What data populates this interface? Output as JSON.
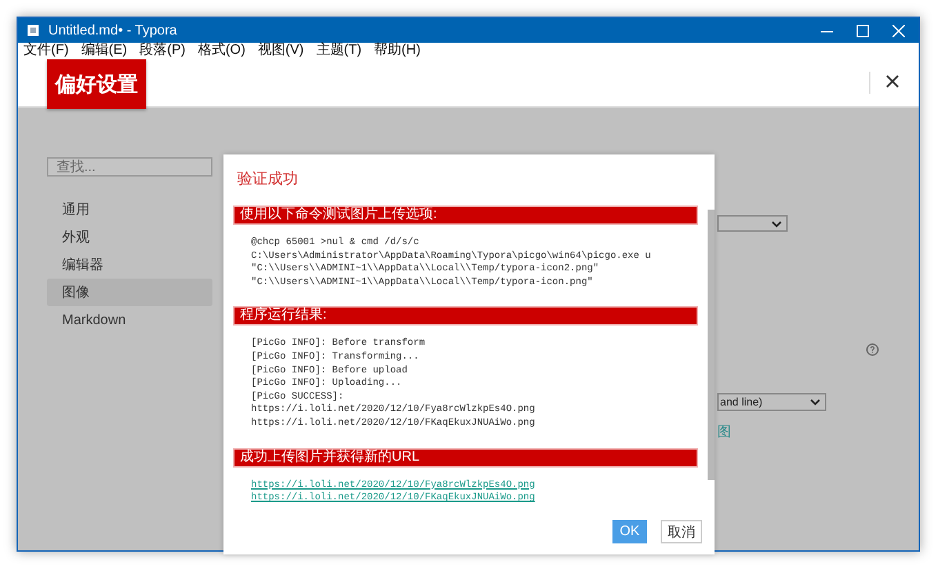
{
  "window": {
    "title": "Untitled.md• - Typora"
  },
  "menu": [
    {
      "label": "文件(F)"
    },
    {
      "label": "编辑(E)"
    },
    {
      "label": "段落(P)"
    },
    {
      "label": "格式(O)"
    },
    {
      "label": "视图(V)"
    },
    {
      "label": "主题(T)"
    },
    {
      "label": "帮助(H)"
    }
  ],
  "preferences": {
    "title": "偏好设置",
    "search": {
      "placeholder": "查找..."
    },
    "sidebar": {
      "items": [
        {
          "label": "通用",
          "selected": false
        },
        {
          "label": "外观",
          "selected": false
        },
        {
          "label": "编辑器",
          "selected": false
        },
        {
          "label": "图像",
          "selected": true
        },
        {
          "label": "Markdown",
          "selected": false
        }
      ]
    },
    "background": {
      "dropdown": {
        "value": "and line)"
      },
      "link": {
        "label": "图"
      }
    }
  },
  "dialog": {
    "title": "验证成功",
    "sections": [
      {
        "heading": "使用以下命令测试图片上传选项:",
        "kind": "code",
        "lines": [
          "@chcp 65001 >nul & cmd /d/s/c",
          "C:\\Users\\Administrator\\AppData\\Roaming\\Typora\\picgo\\win64\\picgo.exe u",
          "\"C:\\\\Users\\\\ADMINI~1\\\\AppData\\\\Local\\\\Temp/typora-icon2.png\"",
          "\"C:\\\\Users\\\\ADMINI~1\\\\AppData\\\\Local\\\\Temp/typora-icon.png\""
        ]
      },
      {
        "heading": "程序运行结果:",
        "kind": "code",
        "lines": [
          "[PicGo INFO]: Before transform",
          "[PicGo INFO]: Transforming...",
          "[PicGo INFO]: Before upload",
          "[PicGo INFO]: Uploading...",
          "[PicGo SUCCESS]:",
          "https://i.loli.net/2020/12/10/Fya8rcWlzkpEs4O.png",
          "https://i.loli.net/2020/12/10/FKaqEkuxJNUAiWo.png"
        ]
      },
      {
        "heading": "成功上传图片并获得新的URL",
        "kind": "links",
        "lines": [
          "https://i.loli.net/2020/12/10/Fya8rcWlzkpEs4O.png",
          "https://i.loli.net/2020/12/10/FKaqEkuxJNUAiWo.png"
        ]
      }
    ],
    "buttons": [
      {
        "label": "OK",
        "kind": "primary"
      },
      {
        "label": "取消",
        "kind": "secondary"
      }
    ]
  }
}
